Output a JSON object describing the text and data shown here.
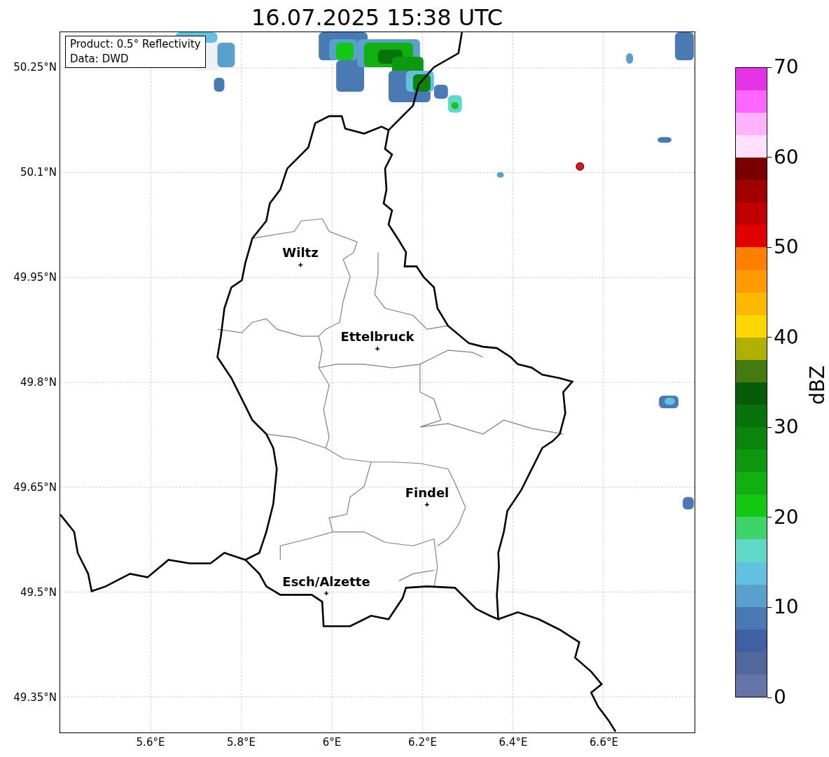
{
  "title": "16.07.2025 15:38 UTC",
  "info_box": [
    "Product: 0.5° Reflectivity",
    "Data: DWD"
  ],
  "lat_ticks": [
    "50.25°N",
    "50.1°N",
    "49.95°N",
    "49.8°N",
    "49.65°N",
    "49.5°N",
    "49.35°N"
  ],
  "lon_ticks": [
    "5.6°E",
    "5.8°E",
    "6°E",
    "6.2°E",
    "6.4°E",
    "6.6°E"
  ],
  "cities": [
    {
      "name": "Wiltz"
    },
    {
      "name": "Ettelbruck"
    },
    {
      "name": "Findel"
    },
    {
      "name": "Esch/Alzette"
    }
  ],
  "colorbar": {
    "label": "dBZ",
    "ticks": [
      "70",
      "60",
      "50",
      "40",
      "30",
      "20",
      "10",
      "0"
    ],
    "segments": [
      {
        "color": "#6474a8"
      },
      {
        "color": "#50689c"
      },
      {
        "color": "#4060a4"
      },
      {
        "color": "#4a7ab4"
      },
      {
        "color": "#5aa0cc"
      },
      {
        "color": "#62c0e0"
      },
      {
        "color": "#5fd8c8"
      },
      {
        "color": "#3dd46a"
      },
      {
        "color": "#12c812"
      },
      {
        "color": "#10b010"
      },
      {
        "color": "#0e980e"
      },
      {
        "color": "#0c850c"
      },
      {
        "color": "#0a720a"
      },
      {
        "color": "#085c08"
      },
      {
        "color": "#457a10"
      },
      {
        "color": "#b0b000"
      },
      {
        "color": "#ffd700"
      },
      {
        "color": "#ffb800"
      },
      {
        "color": "#ff9a00"
      },
      {
        "color": "#ff7f00"
      },
      {
        "color": "#e00000"
      },
      {
        "color": "#c00000"
      },
      {
        "color": "#a00000"
      },
      {
        "color": "#7a0000"
      },
      {
        "color": "#ffe0ff"
      },
      {
        "color": "#ffb3ff"
      },
      {
        "color": "#ff66ff"
      },
      {
        "color": "#e633e6"
      }
    ]
  }
}
